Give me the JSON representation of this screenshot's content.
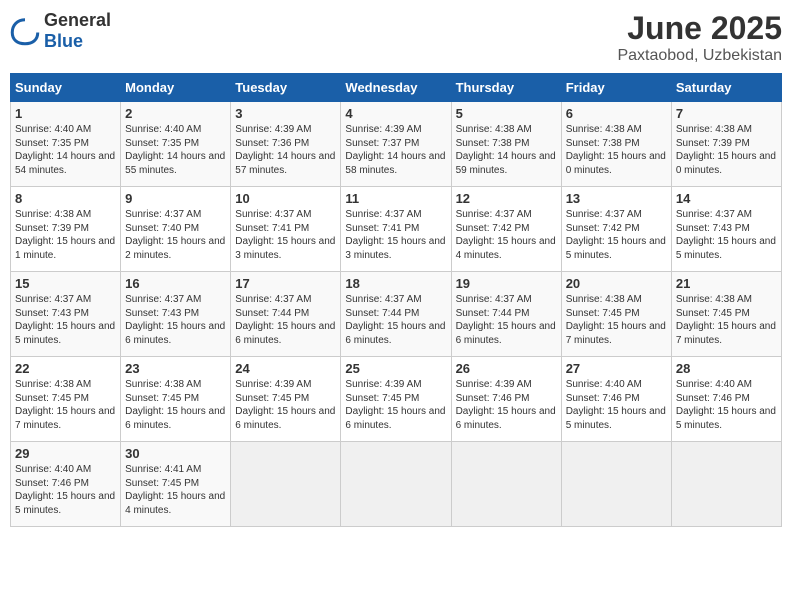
{
  "logo": {
    "general": "General",
    "blue": "Blue"
  },
  "title": "June 2025",
  "location": "Paxtaobod, Uzbekistan",
  "headers": [
    "Sunday",
    "Monday",
    "Tuesday",
    "Wednesday",
    "Thursday",
    "Friday",
    "Saturday"
  ],
  "weeks": [
    [
      {
        "day": "1",
        "sunrise": "4:40 AM",
        "sunset": "7:35 PM",
        "daylight": "14 hours and 54 minutes."
      },
      {
        "day": "2",
        "sunrise": "4:40 AM",
        "sunset": "7:35 PM",
        "daylight": "14 hours and 55 minutes."
      },
      {
        "day": "3",
        "sunrise": "4:39 AM",
        "sunset": "7:36 PM",
        "daylight": "14 hours and 57 minutes."
      },
      {
        "day": "4",
        "sunrise": "4:39 AM",
        "sunset": "7:37 PM",
        "daylight": "14 hours and 58 minutes."
      },
      {
        "day": "5",
        "sunrise": "4:38 AM",
        "sunset": "7:38 PM",
        "daylight": "14 hours and 59 minutes."
      },
      {
        "day": "6",
        "sunrise": "4:38 AM",
        "sunset": "7:38 PM",
        "daylight": "15 hours and 0 minutes."
      },
      {
        "day": "7",
        "sunrise": "4:38 AM",
        "sunset": "7:39 PM",
        "daylight": "15 hours and 0 minutes."
      }
    ],
    [
      {
        "day": "8",
        "sunrise": "4:38 AM",
        "sunset": "7:39 PM",
        "daylight": "15 hours and 1 minute."
      },
      {
        "day": "9",
        "sunrise": "4:37 AM",
        "sunset": "7:40 PM",
        "daylight": "15 hours and 2 minutes."
      },
      {
        "day": "10",
        "sunrise": "4:37 AM",
        "sunset": "7:41 PM",
        "daylight": "15 hours and 3 minutes."
      },
      {
        "day": "11",
        "sunrise": "4:37 AM",
        "sunset": "7:41 PM",
        "daylight": "15 hours and 3 minutes."
      },
      {
        "day": "12",
        "sunrise": "4:37 AM",
        "sunset": "7:42 PM",
        "daylight": "15 hours and 4 minutes."
      },
      {
        "day": "13",
        "sunrise": "4:37 AM",
        "sunset": "7:42 PM",
        "daylight": "15 hours and 5 minutes."
      },
      {
        "day": "14",
        "sunrise": "4:37 AM",
        "sunset": "7:43 PM",
        "daylight": "15 hours and 5 minutes."
      }
    ],
    [
      {
        "day": "15",
        "sunrise": "4:37 AM",
        "sunset": "7:43 PM",
        "daylight": "15 hours and 5 minutes."
      },
      {
        "day": "16",
        "sunrise": "4:37 AM",
        "sunset": "7:43 PM",
        "daylight": "15 hours and 6 minutes."
      },
      {
        "day": "17",
        "sunrise": "4:37 AM",
        "sunset": "7:44 PM",
        "daylight": "15 hours and 6 minutes."
      },
      {
        "day": "18",
        "sunrise": "4:37 AM",
        "sunset": "7:44 PM",
        "daylight": "15 hours and 6 minutes."
      },
      {
        "day": "19",
        "sunrise": "4:37 AM",
        "sunset": "7:44 PM",
        "daylight": "15 hours and 6 minutes."
      },
      {
        "day": "20",
        "sunrise": "4:38 AM",
        "sunset": "7:45 PM",
        "daylight": "15 hours and 7 minutes."
      },
      {
        "day": "21",
        "sunrise": "4:38 AM",
        "sunset": "7:45 PM",
        "daylight": "15 hours and 7 minutes."
      }
    ],
    [
      {
        "day": "22",
        "sunrise": "4:38 AM",
        "sunset": "7:45 PM",
        "daylight": "15 hours and 7 minutes."
      },
      {
        "day": "23",
        "sunrise": "4:38 AM",
        "sunset": "7:45 PM",
        "daylight": "15 hours and 6 minutes."
      },
      {
        "day": "24",
        "sunrise": "4:39 AM",
        "sunset": "7:45 PM",
        "daylight": "15 hours and 6 minutes."
      },
      {
        "day": "25",
        "sunrise": "4:39 AM",
        "sunset": "7:45 PM",
        "daylight": "15 hours and 6 minutes."
      },
      {
        "day": "26",
        "sunrise": "4:39 AM",
        "sunset": "7:46 PM",
        "daylight": "15 hours and 6 minutes."
      },
      {
        "day": "27",
        "sunrise": "4:40 AM",
        "sunset": "7:46 PM",
        "daylight": "15 hours and 5 minutes."
      },
      {
        "day": "28",
        "sunrise": "4:40 AM",
        "sunset": "7:46 PM",
        "daylight": "15 hours and 5 minutes."
      }
    ],
    [
      {
        "day": "29",
        "sunrise": "4:40 AM",
        "sunset": "7:46 PM",
        "daylight": "15 hours and 5 minutes."
      },
      {
        "day": "30",
        "sunrise": "4:41 AM",
        "sunset": "7:45 PM",
        "daylight": "15 hours and 4 minutes."
      },
      null,
      null,
      null,
      null,
      null
    ]
  ]
}
